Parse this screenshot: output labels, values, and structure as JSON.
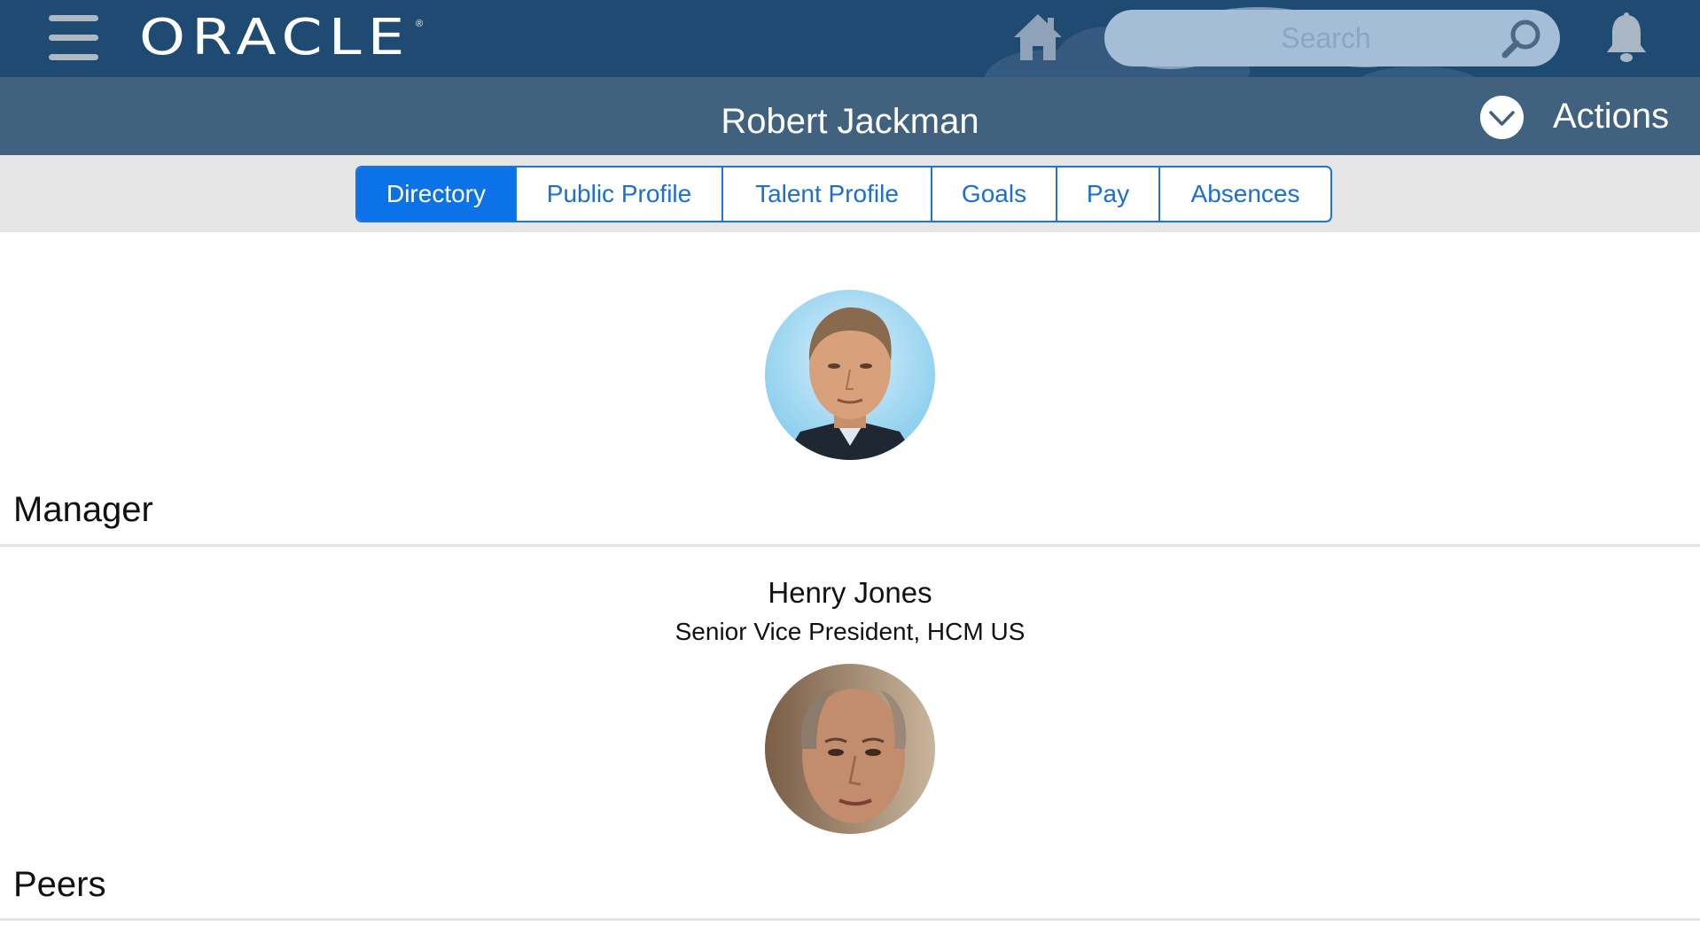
{
  "header": {
    "logo_text": "ORACLE",
    "logo_reg": "®",
    "search_placeholder": "Search",
    "icons": [
      "menu-icon",
      "home-icon",
      "search-icon",
      "bell-icon"
    ],
    "bar_color": "#1f4a72"
  },
  "title_bar": {
    "title": "Robert Jackman",
    "actions_label": "Actions",
    "actions_icon": "chevron-down-icon",
    "bar_color": "#40627f"
  },
  "tabs": {
    "active_color": "#0b72e7",
    "items": [
      {
        "label": "Directory",
        "active": true
      },
      {
        "label": "Public Profile",
        "active": false
      },
      {
        "label": "Talent Profile",
        "active": false
      },
      {
        "label": "Goals",
        "active": false
      },
      {
        "label": "Pay",
        "active": false
      },
      {
        "label": "Absences",
        "active": false
      }
    ]
  },
  "sections": {
    "manager_label": "Manager",
    "peers_label": "Peers"
  },
  "manager": {
    "name": "Henry Jones",
    "title": "Senior Vice President, HCM US"
  }
}
